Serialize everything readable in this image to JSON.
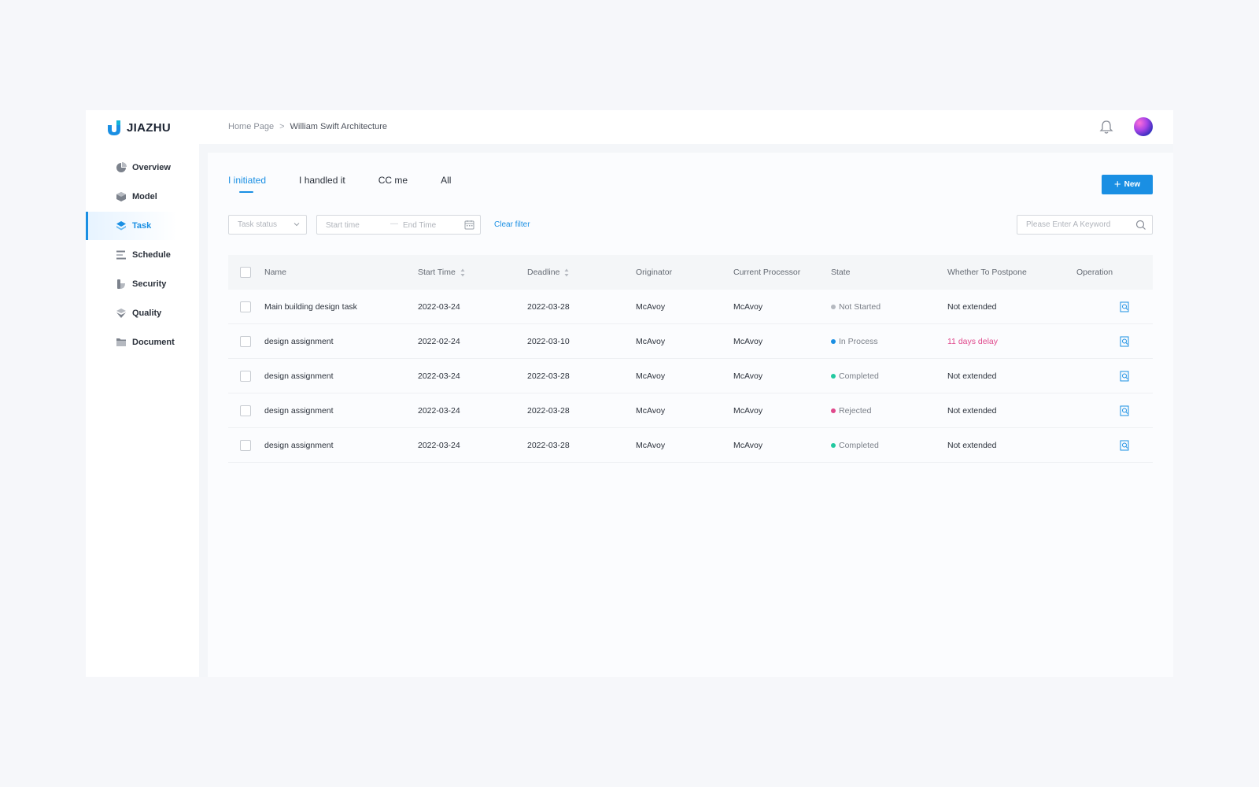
{
  "app": {
    "logo_text": "JIAZHU"
  },
  "breadcrumb": {
    "home": "Home Page",
    "separator": ">",
    "current": "William Swift Architecture"
  },
  "header": {
    "icons": [
      "bell-icon",
      "avatar"
    ]
  },
  "sidebar": {
    "items": [
      {
        "label": "Overview",
        "icon": "pie-chart-icon",
        "active": false
      },
      {
        "label": "Model",
        "icon": "cube-icon",
        "active": false
      },
      {
        "label": "Task",
        "icon": "layers-icon",
        "active": true
      },
      {
        "label": "Schedule",
        "icon": "schedule-bars-icon",
        "active": false
      },
      {
        "label": "Security",
        "icon": "shield-icon",
        "active": false
      },
      {
        "label": "Quality",
        "icon": "quality-icon",
        "active": false
      },
      {
        "label": "Document",
        "icon": "folder-icon",
        "active": false
      }
    ]
  },
  "tabs": [
    {
      "label": "I initiated",
      "active": true
    },
    {
      "label": "I handled it",
      "active": false
    },
    {
      "label": "CC me",
      "active": false
    },
    {
      "label": "All",
      "active": false
    }
  ],
  "toolbar": {
    "new_label": "New"
  },
  "filters": {
    "status_placeholder": "Task status",
    "start_placeholder": "Start time",
    "date_separator": "—",
    "end_placeholder": "End Time",
    "clear_label": "Clear filter",
    "search_placeholder": "Please Enter A Keyword"
  },
  "table": {
    "columns": [
      "Name",
      "Start Time",
      "Deadline",
      "Originator",
      "Current Processor",
      "State",
      "Whether To Postpone",
      "Operation"
    ],
    "rows": [
      {
        "name": "Main building design task",
        "start": "2022-03-24",
        "deadline": "2022-03-28",
        "originator": "McAvoy",
        "processor": "McAvoy",
        "state": "Not Started",
        "postpone": "Not extended"
      },
      {
        "name": "design assignment",
        "start": "2022-02-24",
        "deadline": "2022-03-10",
        "originator": "McAvoy",
        "processor": "McAvoy",
        "state": "In Process",
        "postpone": "11 days delay"
      },
      {
        "name": "design assignment",
        "start": "2022-03-24",
        "deadline": "2022-03-28",
        "originator": "McAvoy",
        "processor": "McAvoy",
        "state": "Completed",
        "postpone": "Not extended"
      },
      {
        "name": "design assignment",
        "start": "2022-03-24",
        "deadline": "2022-03-28",
        "originator": "McAvoy",
        "processor": "McAvoy",
        "state": "Rejected",
        "postpone": "Not extended"
      },
      {
        "name": "design assignment",
        "start": "2022-03-24",
        "deadline": "2022-03-28",
        "originator": "McAvoy",
        "processor": "McAvoy",
        "state": "Completed",
        "postpone": "Not extended"
      }
    ]
  },
  "colors": {
    "accent": "#1a8fe3",
    "state_not_started": "#b5b9c0",
    "state_in_process": "#1a8fe3",
    "state_completed": "#22c9a0",
    "state_rejected": "#e0498c",
    "delay": "#e0498c"
  }
}
